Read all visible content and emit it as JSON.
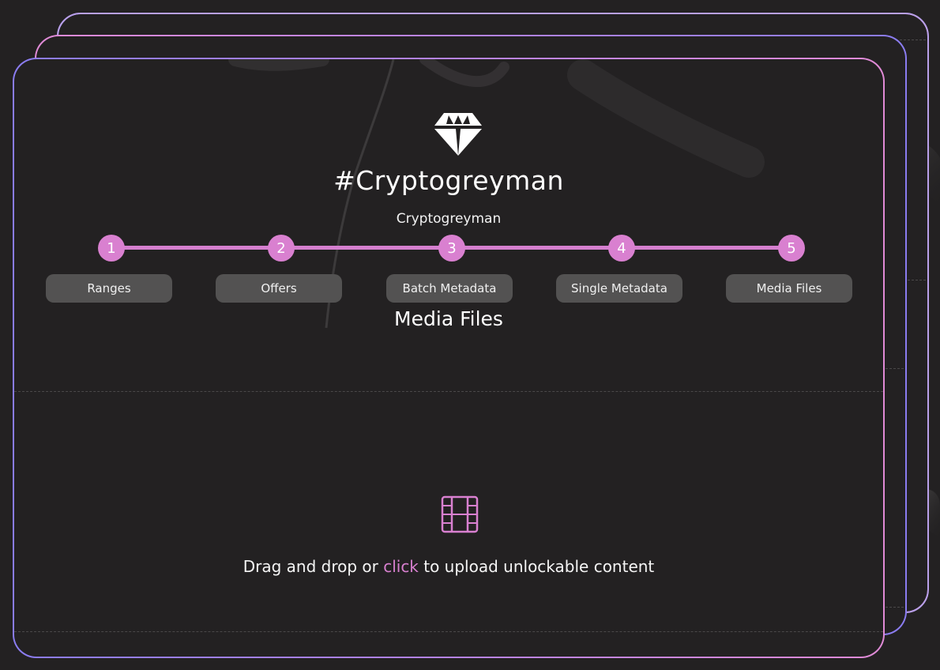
{
  "collection": {
    "title": "#Cryptogreyman",
    "subtitle": "Cryptogreyman",
    "icon": "diamond-icon"
  },
  "steps": [
    {
      "number": "1",
      "label": "Ranges"
    },
    {
      "number": "2",
      "label": "Offers"
    },
    {
      "number": "3",
      "label": "Batch Metadata"
    },
    {
      "number": "4",
      "label": "Single Metadata"
    },
    {
      "number": "5",
      "label": "Media Files"
    }
  ],
  "section_title": "Media Files",
  "upload": {
    "icon": "film-icon",
    "text_before": "Drag and drop or ",
    "link_text": "click",
    "text_after": " to upload unlockable content"
  },
  "colors": {
    "accent": "#d980d0",
    "border_gradient_start": "#8a7cf0",
    "border_gradient_end": "#e08ad6",
    "background": "#232122",
    "pill": "#535252"
  }
}
